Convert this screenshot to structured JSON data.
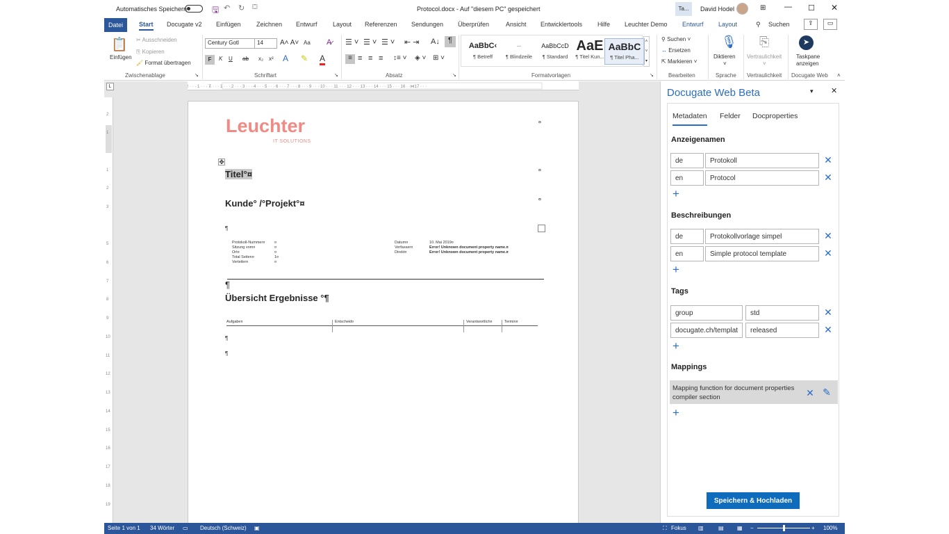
{
  "titlebar": {
    "autosave": "Automatisches Speichern",
    "doc_title": "Protocol.docx - Auf \"diesem PC\" gespeichert",
    "ta": "Ta...",
    "user": "David Hodel"
  },
  "tabs": {
    "datei": "Datei",
    "items": [
      "Start",
      "Docugate v2",
      "Einfügen",
      "Zeichnen",
      "Entwurf",
      "Layout",
      "Referenzen",
      "Sendungen",
      "Überprüfen",
      "Ansicht",
      "Entwicklertools",
      "Hilfe",
      "Leuchter Demo",
      "Entwurf",
      "Layout"
    ],
    "search": "Suchen"
  },
  "ribbon": {
    "clipboard": {
      "paste": "Einfügen",
      "cut": "Ausschneiden",
      "copy": "Kopieren",
      "format": "Format übertragen",
      "label": "Zwischenablage"
    },
    "font": {
      "name": "Century Gotl",
      "size": "14",
      "label": "Schriftart",
      "aa": "Aa"
    },
    "paragraph": {
      "label": "Absatz"
    },
    "styles": {
      "label": "Formatvorlagen",
      "items": [
        {
          "preview": "AaBbC‹",
          "name": "¶ Betreff"
        },
        {
          "preview": "--",
          "name": "¶ Blindzeile"
        },
        {
          "preview": "AaBbCcD",
          "name": "¶ Standard"
        },
        {
          "preview": "AaE",
          "name": "¶ Titel Kun..."
        },
        {
          "preview": "AaBbC",
          "name": "¶ Titel Pha..."
        }
      ]
    },
    "editing": {
      "search": "Suchen",
      "replace": "Ersetzen",
      "select": "Markieren",
      "label": "Bearbeiten"
    },
    "voice": {
      "dictate": "Diktieren",
      "label": "Sprache"
    },
    "sensitivity": {
      "name": "Vertraulichkeit",
      "label": "Vertraulichkeit"
    },
    "docugate": {
      "name": "Taskpane anzeigen",
      "label": "Docugate Web"
    }
  },
  "document": {
    "logo": "Leuchter",
    "logo_sub": "IT SOLUTIONS",
    "title": "Titel°¤",
    "kunde": "Kunde° /°Projekt°¤",
    "pilcrow": "¶",
    "meta_left": [
      "Protokoll-Nummer¤",
      "Sitzung vom¤",
      "Ort¤",
      "Total Seiten¤",
      "Verteiler¤"
    ],
    "meta_left_vals": [
      "¤",
      "¤",
      "¤",
      "1¤",
      "¤"
    ],
    "meta_right_labels": [
      "Datum¤",
      "Verfasser¤",
      "Direkt¤"
    ],
    "meta_right_vals": [
      "10. Mai 2019¤",
      "Error! Unknown document property name.¤",
      "Error! Unknown document property name.¤"
    ],
    "heading2": "Übersicht Ergebnisse °¶",
    "table_headers": [
      "Aufgabe¤",
      "Entscheid¤",
      "Verantwortlich¤",
      "Termin¤"
    ]
  },
  "pane": {
    "title": "Docugate Web Beta",
    "tabs": [
      "Metadaten",
      "Felder",
      "Docproperties"
    ],
    "sections": {
      "display": "Anzeigenamen",
      "desc": "Beschreibungen",
      "tags": "Tags",
      "mappings": "Mappings"
    },
    "display_names": [
      {
        "lang": "de",
        "value": "Protokoll"
      },
      {
        "lang": "en",
        "value": "Protocol"
      }
    ],
    "descriptions": [
      {
        "lang": "de",
        "value": "Protokollvorlage simpel"
      },
      {
        "lang": "en",
        "value": "Simple protocol template"
      }
    ],
    "tags": [
      {
        "key": "group",
        "value": "std"
      },
      {
        "key": "docugate.ch/templat",
        "value": "released"
      }
    ],
    "mapping": "Mapping function for document properties compiler section",
    "save": "Speichern & Hochladen"
  },
  "status": {
    "page": "Seite 1 von 1",
    "words": "34 Wörter",
    "lang": "Deutsch (Schweiz)",
    "focus": "Fokus",
    "zoom": "100%"
  },
  "colors": {
    "accent": "#2b579a",
    "pane_blue": "#0f6cbd",
    "logo": "#ee8b84"
  }
}
